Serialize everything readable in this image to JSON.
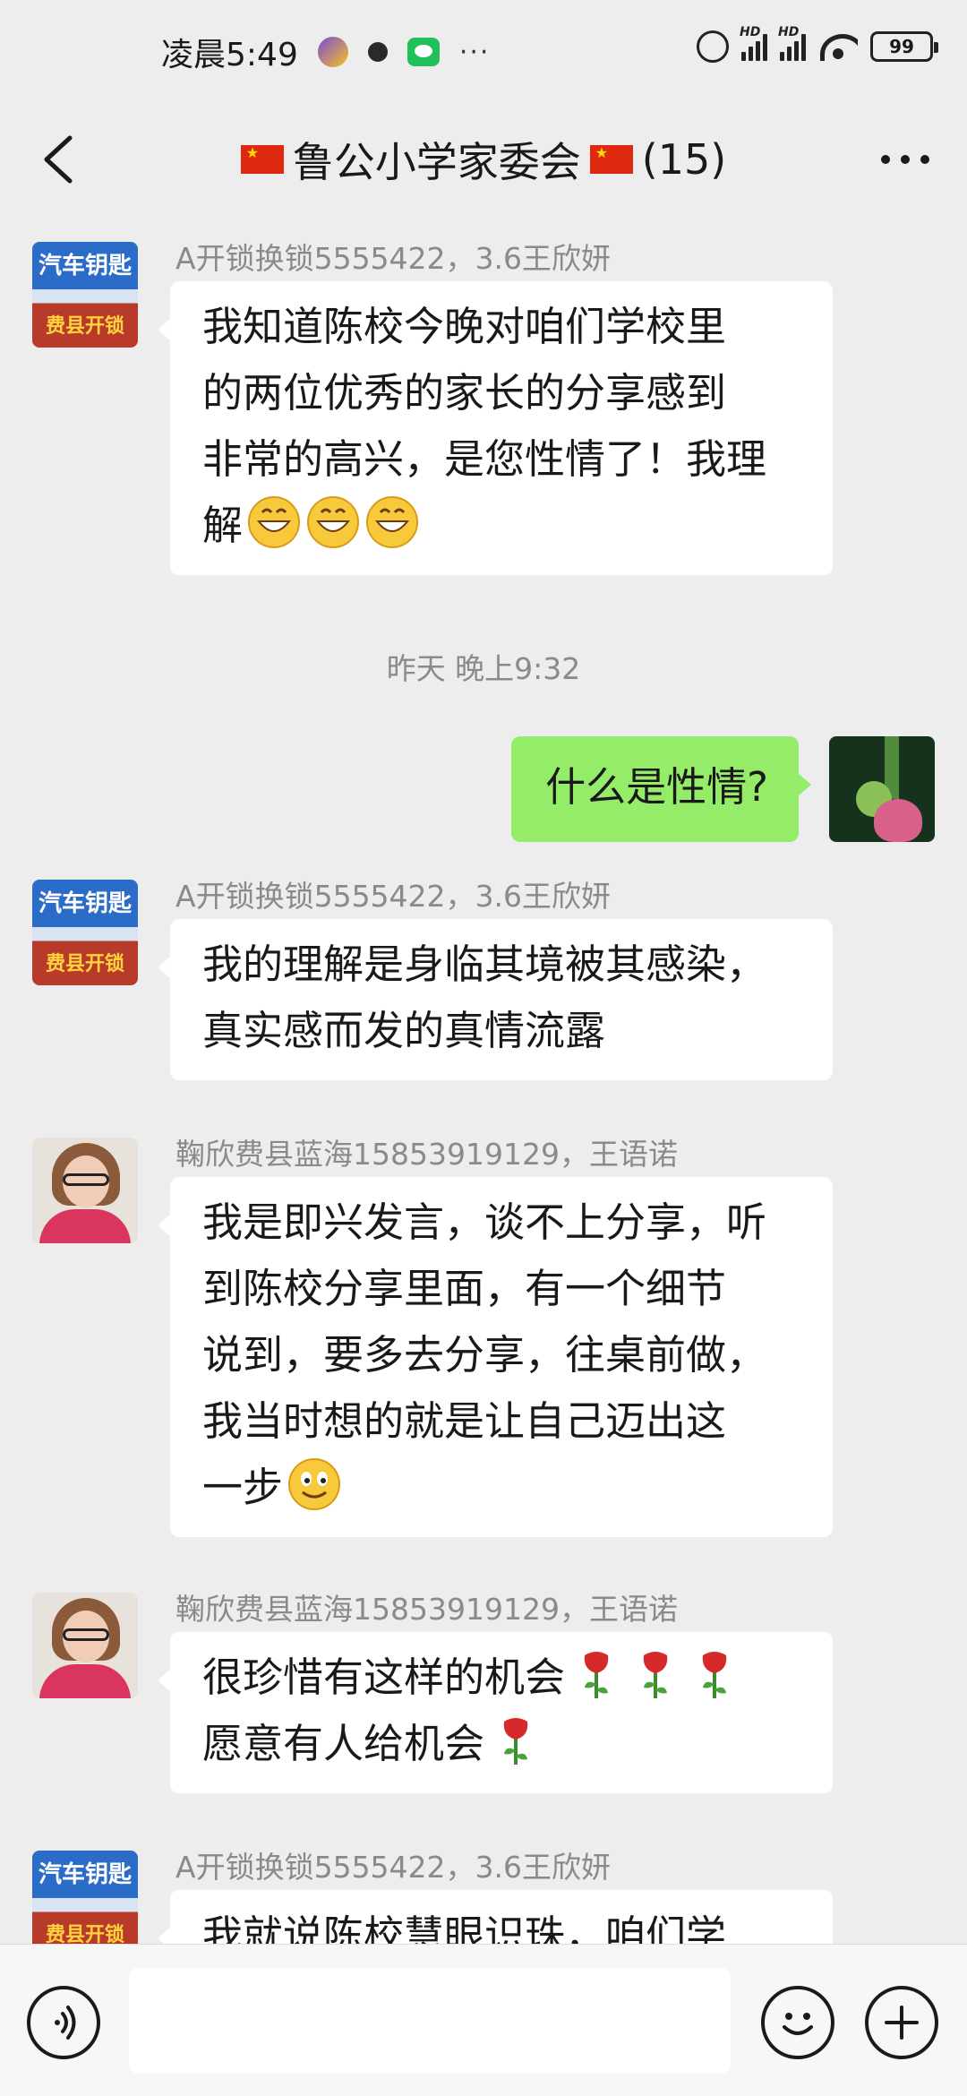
{
  "status_bar": {
    "time": "凌晨5:49",
    "dots": "···",
    "battery": "99",
    "hd1": "HD",
    "hd2": "HD"
  },
  "nav": {
    "title": "鲁公小学家委会",
    "member_count": "(15)"
  },
  "messages": [
    {
      "sender": "A开锁换锁5555422，3.6王欣妍",
      "lines": [
        "我知道陈校今晚对咱们学校里",
        "的两位优秀的家长的分享感到",
        "非常的高兴，是您性情了！我理",
        "解"
      ],
      "avatar_text_top": "汽车钥匙",
      "avatar_text_bottom": "费县开锁"
    },
    {
      "type": "timestamp",
      "text": "昨天 晚上9:32"
    },
    {
      "self": true,
      "text": "什么是性情?"
    },
    {
      "sender": "A开锁换锁5555422，3.6王欣妍",
      "lines": [
        "我的理解是身临其境被其感染，",
        "真实感而发的真情流露"
      ]
    },
    {
      "sender": "鞠欣费县蓝海15853919129，王语诺",
      "lines": [
        "我是即兴发言，谈不上分享，听",
        "到陈校分享里面，有一个细节",
        "说到，要多去分享，往桌前做，",
        "我当时想的就是让自己迈出这",
        "一步"
      ]
    },
    {
      "sender": "鞠欣费县蓝海15853919129，王语诺",
      "lines": [
        "很珍惜有这样的机会",
        "愿意有人给机会"
      ]
    },
    {
      "sender": "A开锁换锁5555422，3.6王欣妍",
      "lines": [
        "我就说陈校慧眼识珠，咱们学"
      ]
    }
  ],
  "input": {
    "value": ""
  },
  "colors": {
    "self_bubble": "#95ec69",
    "other_bubble": "#ffffff",
    "background": "#ededed"
  },
  "icons": [
    "back-arrow-icon",
    "more-icon",
    "voice-icon",
    "emoji-icon",
    "plus-icon",
    "grin-emoji",
    "smile-emoji",
    "rose-emoji"
  ]
}
